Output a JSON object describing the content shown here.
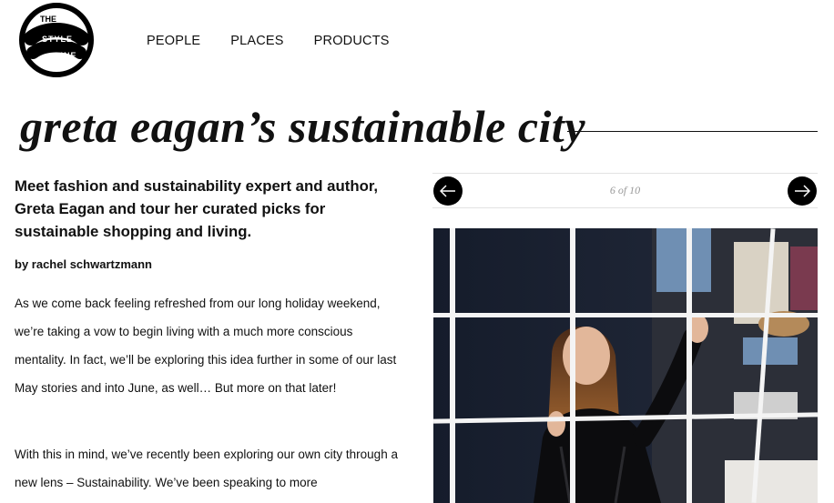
{
  "header": {
    "logo_text": [
      "THE",
      "STYLE",
      "LINE"
    ],
    "nav": [
      {
        "label": "PEOPLE"
      },
      {
        "label": "PLACES"
      },
      {
        "label": "PRODUCTS"
      }
    ]
  },
  "article": {
    "title": "greta eagan’s sustainable city",
    "lede": "Meet fashion and sustainability expert and author, Greta Eagan and tour her curated picks for sustainable shopping and living.",
    "byline": "by rachel schwartzmann",
    "paragraphs": [
      "As we come back feeling refreshed from our long holiday weekend, we’re taking a vow to begin living with a much more conscious mentality. In fact, we’ll be exploring this idea further in some of our last May stories and into June, as well… But more on that later!",
      "With this in mind, we’ve recently been exploring our own city through a new lens – Sustainability. We’ve been speaking to more"
    ]
  },
  "gallery": {
    "counter": "6 of 10",
    "prev_icon": "arrow-left-icon",
    "next_icon": "arrow-right-icon"
  },
  "colors": {
    "accent": "#000000",
    "rule": "#e2e2e2",
    "muted": "#999999"
  }
}
